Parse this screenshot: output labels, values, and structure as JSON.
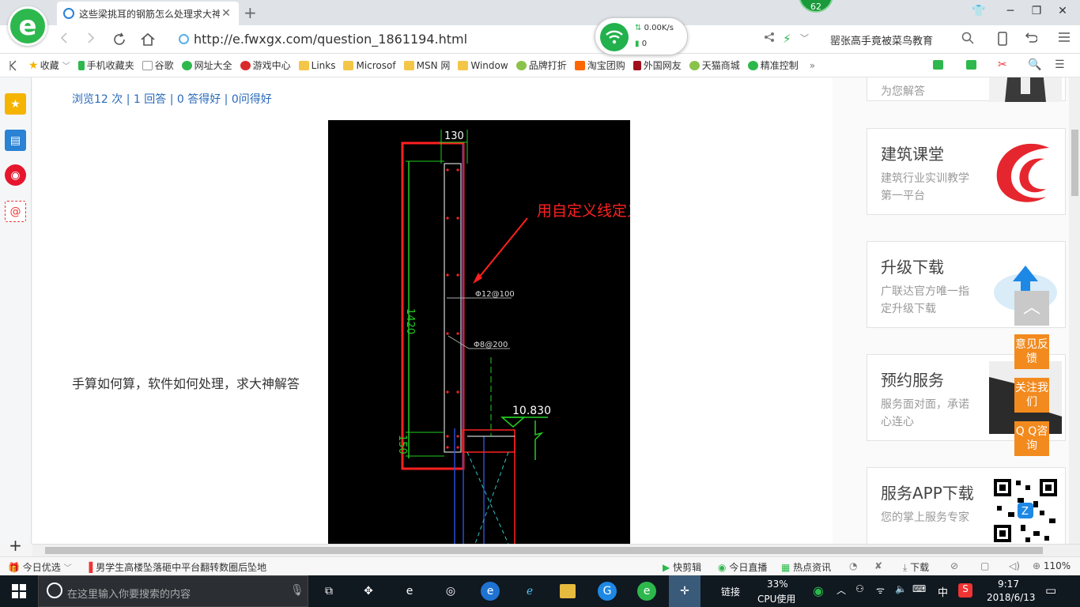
{
  "tab": {
    "title": "这些梁挑耳的钢筋怎么处理求大神",
    "close": "✕",
    "new": "+"
  },
  "badge": "62",
  "window": {
    "minimize": "─",
    "restore": "❐",
    "close": "✕",
    "skin": "👕"
  },
  "address": {
    "url_prefix": "http://e.",
    "url_domain": "fwxgx.com",
    "url_path": "/question_1861194.html"
  },
  "wifi": {
    "rate": "0.00K/s",
    "count": "0"
  },
  "search": {
    "text": "罂张高手竟被菜鸟教育"
  },
  "bookmarks": [
    {
      "label": "收藏"
    },
    {
      "label": "手机收藏夹"
    },
    {
      "label": "谷歌"
    },
    {
      "label": "网址大全"
    },
    {
      "label": "游戏中心"
    },
    {
      "label": "Links"
    },
    {
      "label": "Microsof"
    },
    {
      "label": "MSN 网"
    },
    {
      "label": "Window"
    },
    {
      "label": "品牌打折"
    },
    {
      "label": "淘宝团购"
    },
    {
      "label": "外国网友"
    },
    {
      "label": "天猫商城"
    },
    {
      "label": "精准控制"
    }
  ],
  "bookmarks_more": "»",
  "content": {
    "stats": "浏览12 次 | 1 回答 | 0 答得好 | 0问得好",
    "question": "手算如何算，软件如何处理，求大神解答"
  },
  "cad": {
    "dim_top": "130",
    "dim_height": "1420",
    "dim_bottom": "150",
    "annotation": "用自定义线定义",
    "rebar1": "Φ12@100",
    "rebar2": "Φ8@200",
    "elevation": "10.830"
  },
  "ads": [
    {
      "title": "",
      "sub": "为您解答"
    },
    {
      "title": "建筑课堂",
      "sub": "建筑行业实训教学第一平台"
    },
    {
      "title": "升级下载",
      "sub": "广联达官方唯一指定升级下载"
    },
    {
      "title": "预约服务",
      "sub": "服务面对面，承诺心连心"
    },
    {
      "title": "服务APP下载",
      "sub": "您的掌上服务专家"
    }
  ],
  "float_buttons": {
    "backtop": "︿",
    "feedback": "意见反馈",
    "follow": "关注我们",
    "qq": "Q Q咨询"
  },
  "statusbar": {
    "today": "今日优选",
    "news": "男学生高楼坠落砸中平台翻转数圈后坠地",
    "kuaijianji": "快剪辑",
    "zhibo": "今日直播",
    "hot": "热点资讯",
    "download": "下载",
    "zoom": "110%"
  },
  "taskbar": {
    "search_placeholder": "在这里输入你要搜索的内容",
    "link": "链接",
    "cpu_pct": "33%",
    "cpu_label": "CPU使用",
    "ime": "中",
    "time": "9:17",
    "date": "2018/6/13"
  },
  "colors": {
    "accent_green": "#2db84d",
    "link_blue": "#2a6ab8",
    "orange": "#f28a1e",
    "cad_red": "#ff2020"
  }
}
